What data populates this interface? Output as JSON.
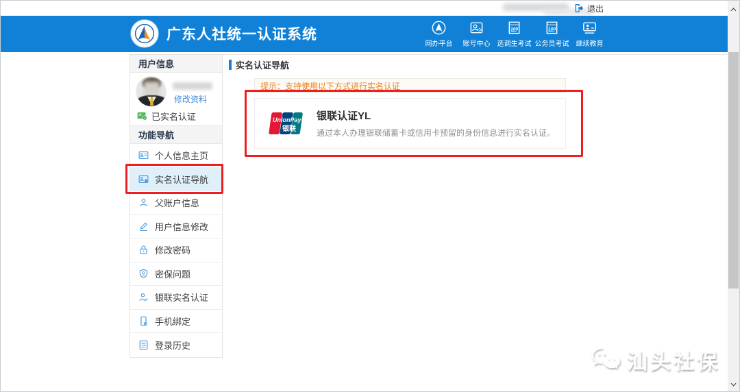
{
  "topbar": {
    "logout_label": "退出"
  },
  "header": {
    "title": "广东人社统一认证系统",
    "nav": [
      {
        "label": "网办平台",
        "icon": "portal-icon"
      },
      {
        "label": "账号中心",
        "icon": "account-center-icon"
      },
      {
        "label": "选调生考试",
        "icon": "exam-100-icon"
      },
      {
        "label": "公务员考试",
        "icon": "exam-100-icon"
      },
      {
        "label": "继续教育",
        "icon": "education-icon"
      }
    ]
  },
  "sidebar": {
    "user_section_title": "用户信息",
    "edit_profile_label": "修改资料",
    "verified_label": "已实名认证",
    "nav_section_title": "功能导航",
    "menu": [
      {
        "label": "个人信息主页",
        "icon": "id-card-icon",
        "active": false
      },
      {
        "label": "实名认证导航",
        "icon": "auth-card-icon",
        "active": true
      },
      {
        "label": "父账户信息",
        "icon": "person-icon",
        "active": false
      },
      {
        "label": "用户信息修改",
        "icon": "pencil-icon",
        "active": false
      },
      {
        "label": "修改密码",
        "icon": "lock-icon",
        "active": false
      },
      {
        "label": "密保问题",
        "icon": "shield-icon",
        "active": false
      },
      {
        "label": "银联实名认证",
        "icon": "person-check-icon",
        "active": false
      },
      {
        "label": "手机绑定",
        "icon": "phone-icon",
        "active": false
      },
      {
        "label": "登录历史",
        "icon": "history-icon",
        "active": false
      }
    ]
  },
  "main": {
    "page_title": "实名认证导航",
    "notice": "提示：支持使用以下方式进行实名认证",
    "card": {
      "logo_text_top": "UnionPay",
      "logo_text_bottom": "银联",
      "title": "银联认证YL",
      "description": "通过本人办理银联储蓄卡或信用卡预留的身份信息进行实名认证。"
    }
  },
  "watermark": {
    "text": "汕头社保"
  },
  "colors": {
    "header_blue": "#1081d6",
    "annotation_red": "#ef1d1d",
    "notice_orange": "#f08018",
    "link_blue": "#3d8fdd",
    "icon_blue": "#4a97d8",
    "verified_green": "#55b95c",
    "unionpay_red": "#e21836",
    "unionpay_blue": "#00447c",
    "unionpay_teal": "#007b84"
  }
}
